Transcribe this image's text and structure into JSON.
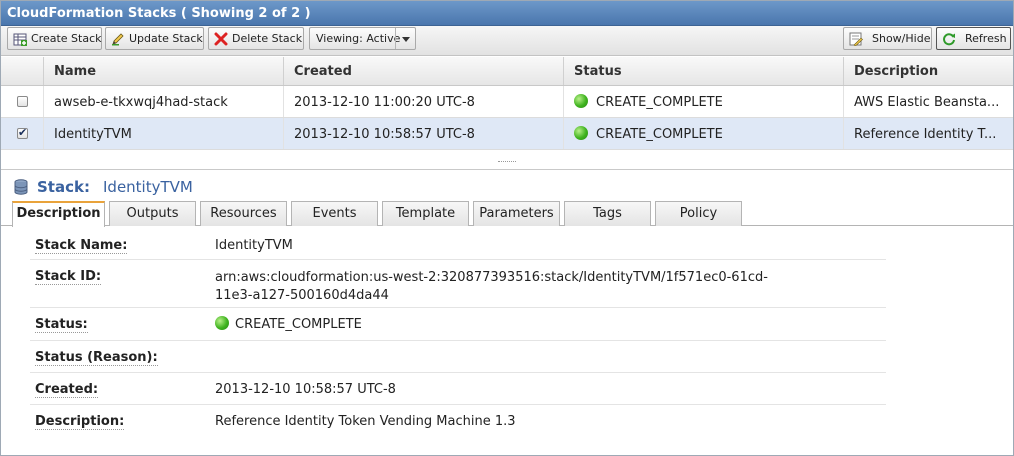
{
  "window": {
    "title": "CloudFormation Stacks ( Showing 2 of 2 )"
  },
  "toolbar": {
    "create": "Create Stack",
    "update": "Update Stack",
    "delete": "Delete Stack",
    "viewing": "Viewing: Active",
    "showhide": "Show/Hide",
    "refresh": "Refresh"
  },
  "grid": {
    "columns": [
      "Name",
      "Created",
      "Status",
      "Description"
    ],
    "rows": [
      {
        "checked": false,
        "name": "awseb-e-tkxwqj4had-stack",
        "created": "2013-12-10 11:00:20 UTC-8",
        "status": "CREATE_COMPLETE",
        "description": "AWS Elastic Beansta..."
      },
      {
        "checked": true,
        "name": "IdentityTVM",
        "created": "2013-12-10 10:58:57 UTC-8",
        "status": "CREATE_COMPLETE",
        "description": "Reference Identity T..."
      }
    ]
  },
  "detail": {
    "heading_key": "Stack:",
    "heading_value": "IdentityTVM",
    "tabs": [
      "Description",
      "Outputs",
      "Resources",
      "Events",
      "Template",
      "Parameters",
      "Tags",
      "Policy"
    ],
    "fields": {
      "stack_name_label": "Stack Name:",
      "stack_name": "IdentityTVM",
      "stack_id_label": "Stack ID:",
      "stack_id_line1": "arn:aws:cloudformation:us-west-2:320877393516:stack/IdentityTVM/1f571ec0-61cd-",
      "stack_id_line2": "11e3-a127-500160d4da44",
      "status_label": "Status:",
      "status": "CREATE_COMPLETE",
      "status_reason_label": "Status (Reason):",
      "status_reason": "",
      "created_label": "Created:",
      "created": "2013-12-10 10:58:57 UTC-8",
      "description_label": "Description:",
      "description": "Reference Identity Token Vending Machine 1.3"
    }
  },
  "colors": {
    "title_bar": "#4a76ad",
    "selected_row": "#dfe8f6",
    "status_ok": "#3fb31f",
    "active_tab_accent": "#e9a33b"
  }
}
